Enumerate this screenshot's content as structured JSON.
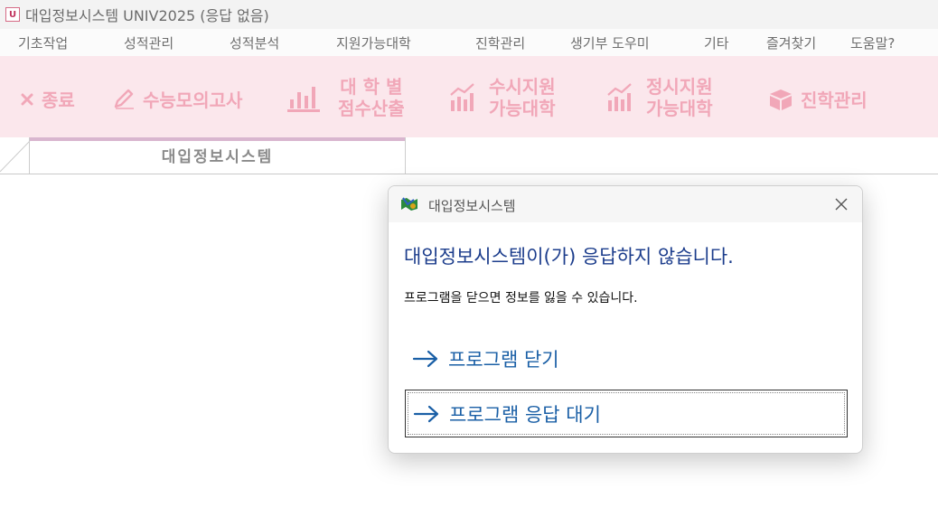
{
  "window": {
    "icon_text": "U",
    "title": "대입정보시스템 UNIV2025 (응답 없음)"
  },
  "menu": [
    {
      "label": "기초작업"
    },
    {
      "label": "성적관리"
    },
    {
      "label": "성적분석"
    },
    {
      "label": "지원가능대학"
    },
    {
      "label": "진학관리"
    },
    {
      "label": "생기부 도우미"
    },
    {
      "label": "기타"
    },
    {
      "label": "즐겨찾기"
    },
    {
      "label": "도움말?"
    }
  ],
  "ribbon": {
    "exit": {
      "label": "종료",
      "icon": "x-icon"
    },
    "mock_exam": {
      "label": "수능모의고사",
      "icon": "pencil-icon"
    },
    "score_by_univ": {
      "line1": "대 학 별",
      "line2": "점수산출",
      "icon": "bar-chart-icon"
    },
    "early_apply": {
      "line1": "수시지원",
      "line2": "가능대학",
      "icon": "trend-chart-icon"
    },
    "regular_apply": {
      "line1": "정시지원",
      "line2": "가능대학",
      "icon": "trend-chart-icon"
    },
    "admission_mgmt": {
      "label": "진학관리",
      "icon": "box-icon"
    },
    "color": "#f1a7b8",
    "background": "#fbe7ec"
  },
  "tabs": [
    {
      "label": "대입정보시스템"
    }
  ],
  "dialog": {
    "title": "대입정보시스템",
    "heading": "대입정보시스템이(가) 응답하지 않습니다.",
    "message": "프로그램을 닫으면 정보를 잃을 수 있습니다.",
    "options": [
      {
        "label": "프로그램 닫기",
        "icon": "arrow-right-icon",
        "focused": false
      },
      {
        "label": "프로그램 응답 대기",
        "icon": "arrow-right-icon",
        "focused": true
      }
    ],
    "accent_color": "#1a5fa6"
  }
}
